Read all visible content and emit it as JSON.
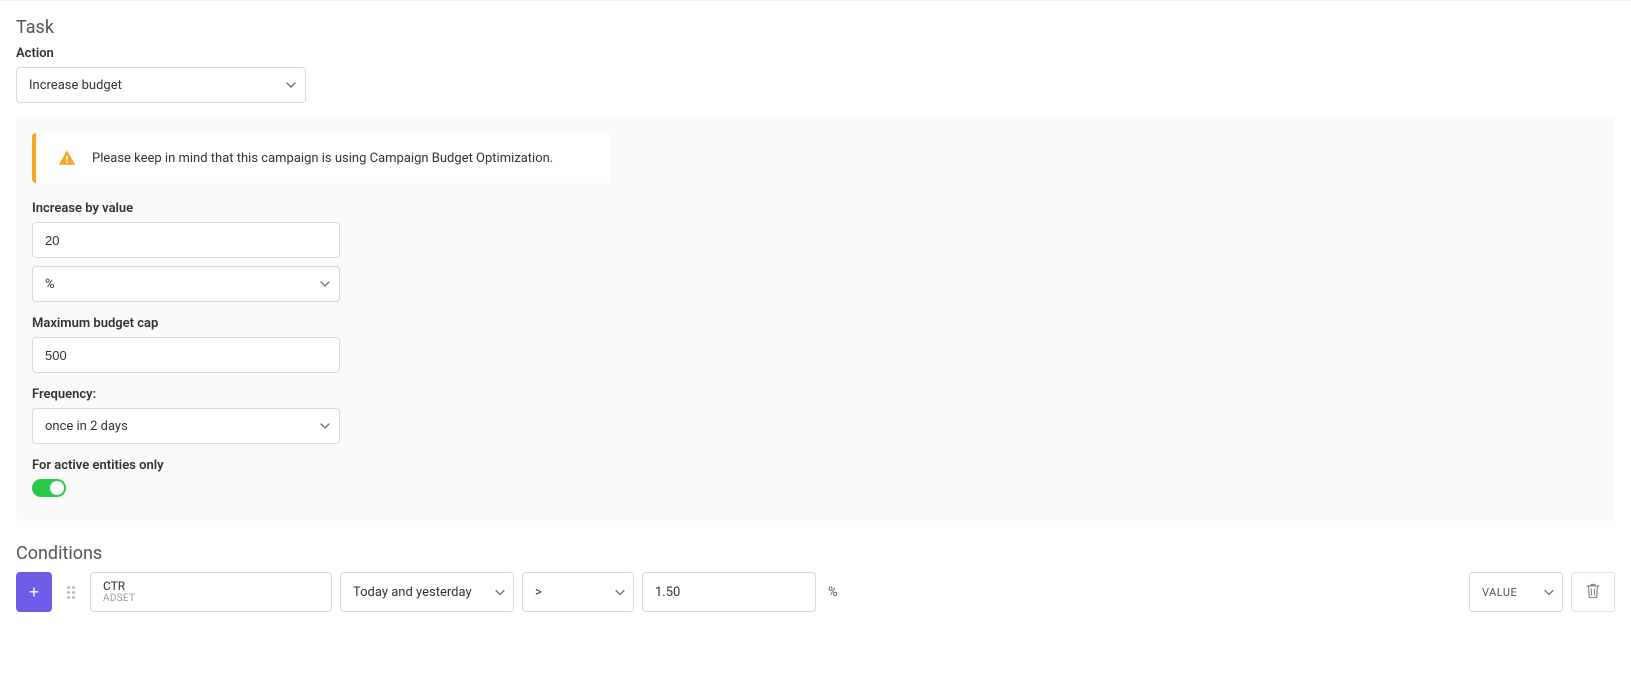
{
  "task": {
    "title": "Task",
    "action_label": "Action",
    "action_value": "Increase budget"
  },
  "alert": {
    "text": "Please keep in mind that this campaign is using Campaign Budget Optimization."
  },
  "increase": {
    "label": "Increase by value",
    "value": "20",
    "unit": "%"
  },
  "max_cap": {
    "label": "Maximum budget cap",
    "value": "500"
  },
  "frequency": {
    "label": "Frequency:",
    "value": "once in 2 days"
  },
  "active_only": {
    "label": "For active entities only",
    "enabled": true
  },
  "conditions": {
    "title": "Conditions",
    "row": {
      "metric_name": "CTR",
      "metric_level": "ADSET",
      "timeframe": "Today and yesterday",
      "operator": ">",
      "value": "1.50",
      "unit": "%",
      "type": "VALUE"
    }
  }
}
